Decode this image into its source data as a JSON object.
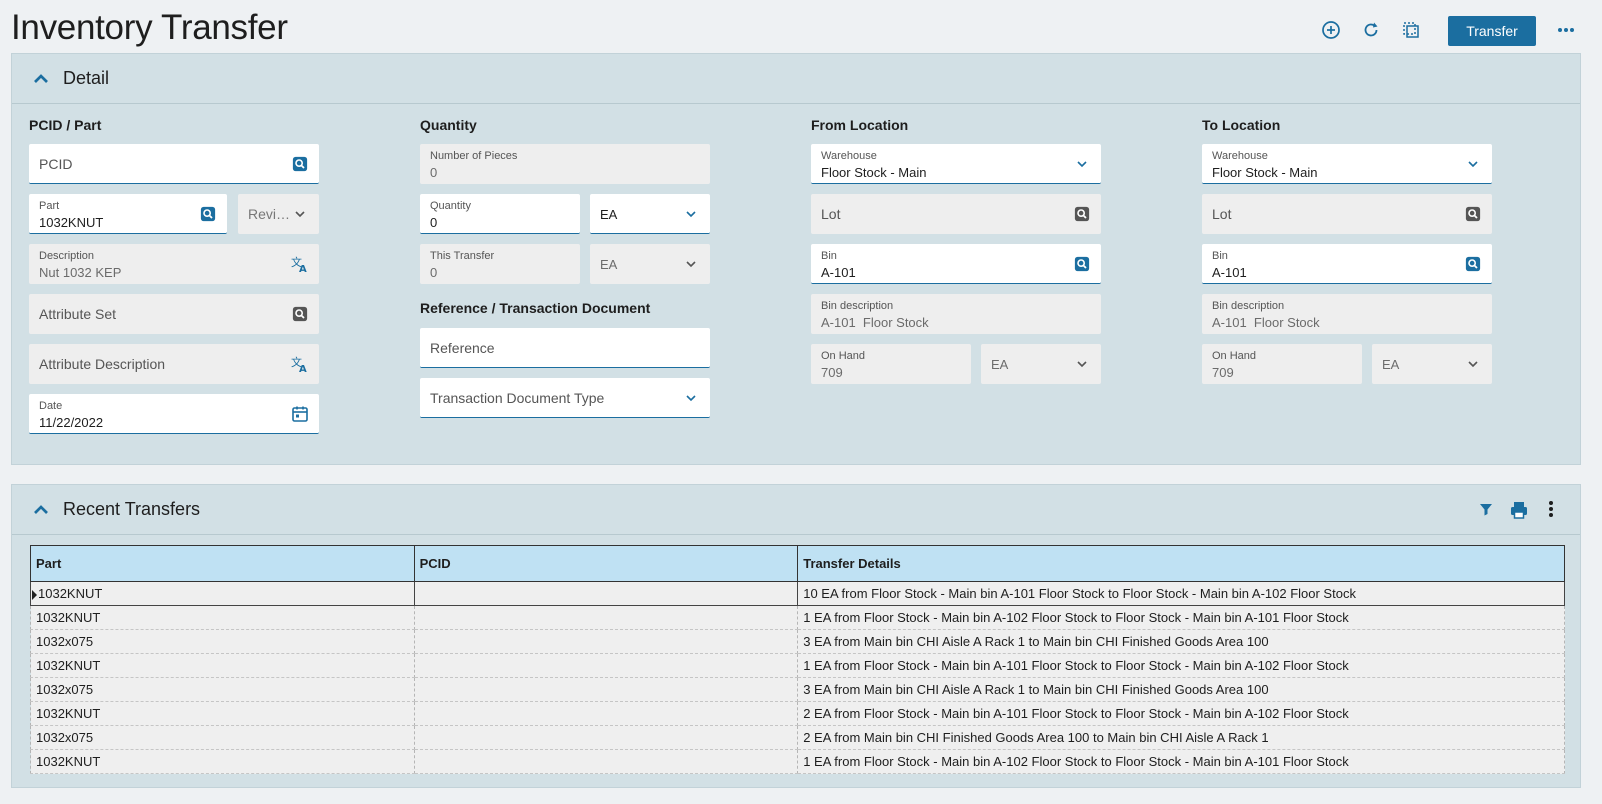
{
  "page": {
    "title": "Inventory Transfer",
    "transfer_label": "Transfer"
  },
  "colors": {
    "accent": "#1b6ea0",
    "panel": "#d2e0e5",
    "header_cell": "#bfe1f3"
  },
  "detail": {
    "title": "Detail",
    "pcid_part": {
      "heading": "PCID / Part",
      "pcid_placeholder": "PCID",
      "part_label": "Part",
      "part_value": "1032KNUT",
      "revision_placeholder": "Revi…",
      "description_label": "Description",
      "description_value": "Nut 1032 KEP",
      "attribute_set_placeholder": "Attribute Set",
      "attribute_description_placeholder": "Attribute Description",
      "date_label": "Date",
      "date_value": "11/22/2022"
    },
    "quantity": {
      "heading": "Quantity",
      "pieces_label": "Number of Pieces",
      "pieces_value": "0",
      "quantity_label": "Quantity",
      "quantity_value": "0",
      "quantity_uom": "EA",
      "this_transfer_label": "This Transfer",
      "this_transfer_value": "0",
      "this_transfer_uom": "EA",
      "ref_heading": "Reference / Transaction Document",
      "reference_placeholder": "Reference",
      "doc_type_placeholder": "Transaction Document Type"
    },
    "from": {
      "heading": "From Location",
      "warehouse_label": "Warehouse",
      "warehouse_value": "Floor Stock - Main",
      "lot_placeholder": "Lot",
      "bin_label": "Bin",
      "bin_value": "A-101",
      "bin_desc_label": "Bin description",
      "bin_desc_value": "A-101  Floor Stock",
      "onhand_label": "On Hand",
      "onhand_value": "709",
      "onhand_uom": "EA"
    },
    "to": {
      "heading": "To Location",
      "warehouse_label": "Warehouse",
      "warehouse_value": "Floor Stock - Main",
      "lot_placeholder": "Lot",
      "bin_label": "Bin",
      "bin_value": "A-101",
      "bin_desc_label": "Bin description",
      "bin_desc_value": "A-101  Floor Stock",
      "onhand_label": "On Hand",
      "onhand_value": "709",
      "onhand_uom": "EA"
    }
  },
  "recent": {
    "title": "Recent Transfers",
    "columns": [
      "Part",
      "PCID",
      "Transfer Details"
    ],
    "rows": [
      {
        "part": "1032KNUT",
        "pcid": "",
        "details": "10 EA from Floor Stock - Main bin A-101 Floor Stock to Floor Stock - Main bin A-102 Floor Stock"
      },
      {
        "part": "1032KNUT",
        "pcid": "",
        "details": "1 EA from Floor Stock - Main bin A-102 Floor Stock to Floor Stock - Main bin A-101 Floor Stock"
      },
      {
        "part": "1032x075",
        "pcid": "",
        "details": "3 EA from Main bin CHI Aisle A Rack 1 to Main bin CHI Finished Goods Area 100"
      },
      {
        "part": "1032KNUT",
        "pcid": "",
        "details": "1 EA from Floor Stock - Main bin A-101 Floor Stock to Floor Stock - Main bin A-102 Floor Stock"
      },
      {
        "part": "1032x075",
        "pcid": "",
        "details": "3 EA from Main bin CHI Aisle A Rack 1 to Main bin CHI Finished Goods Area 100"
      },
      {
        "part": "1032KNUT",
        "pcid": "",
        "details": "2 EA from Floor Stock - Main bin A-101 Floor Stock to Floor Stock - Main bin A-102 Floor Stock"
      },
      {
        "part": "1032x075",
        "pcid": "",
        "details": "2 EA from Main bin CHI Finished Goods Area 100 to Main bin CHI Aisle A Rack 1"
      },
      {
        "part": "1032KNUT",
        "pcid": "",
        "details": "1 EA from Floor Stock - Main bin A-102 Floor Stock to Floor Stock - Main bin A-101 Floor Stock"
      }
    ]
  }
}
